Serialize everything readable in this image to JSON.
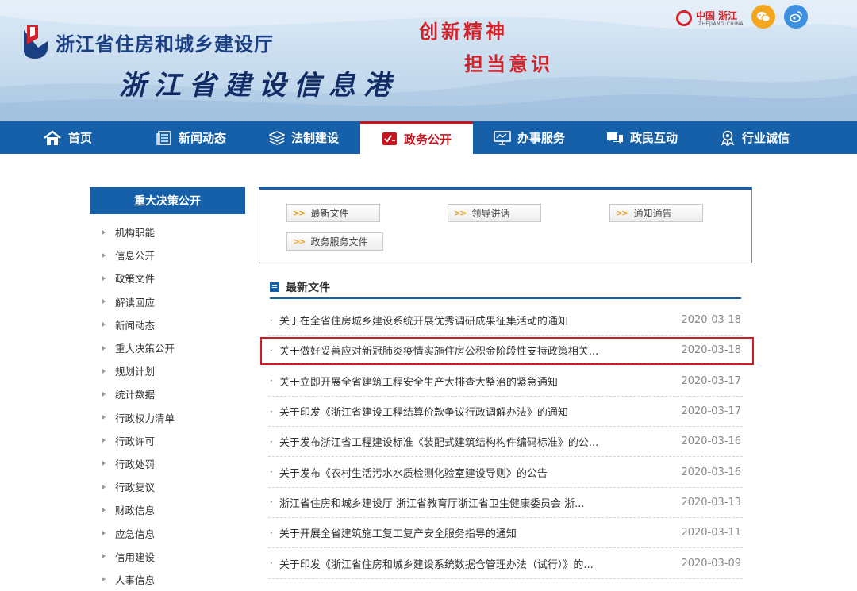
{
  "header": {
    "dept_name": "浙江省住房和城乡建设厅",
    "site_name": "浙江省建设信息港",
    "slogan_1": "创新精神",
    "slogan_2": "担当意识",
    "brand_cn": "中国 浙江",
    "brand_en": "ZHEJIANG·CHINA"
  },
  "nav": {
    "items": [
      {
        "label": "首页",
        "icon": "home-icon"
      },
      {
        "label": "新闻动态",
        "icon": "newspaper-icon"
      },
      {
        "label": "法制建设",
        "icon": "layers-icon"
      },
      {
        "label": "政务公开",
        "icon": "checklist-icon",
        "active": true
      },
      {
        "label": "办事服务",
        "icon": "monitor-icon"
      },
      {
        "label": "政民互动",
        "icon": "chat-icon"
      },
      {
        "label": "行业诚信",
        "icon": "award-icon"
      }
    ]
  },
  "sidebar": {
    "title": "重大决策公开",
    "items": [
      "机构职能",
      "信息公开",
      "政策文件",
      "解读回应",
      "新闻动态",
      "重大决策公开",
      "规划计划",
      "统计数据",
      "行政权力清单",
      "行政许可",
      "行政处罚",
      "行政复议",
      "财政信息",
      "应急信息",
      "信用建设",
      "人事信息"
    ]
  },
  "categories": [
    "最新文件",
    "领导讲话",
    "通知通告",
    "政务服务文件"
  ],
  "section": {
    "title": "最新文件"
  },
  "news": [
    {
      "title": "关于在全省住房城乡建设系统开展优秀调研成果征集活动的通知",
      "date": "2020-03-18"
    },
    {
      "title": "关于做好妥善应对新冠肺炎疫情实施住房公积金阶段性支持政策相关...",
      "date": "2020-03-18"
    },
    {
      "title": "关于立即开展全省建筑工程安全生产大排查大整治的紧急通知",
      "date": "2020-03-17"
    },
    {
      "title": "关于印发《浙江省建设工程结算价款争议行政调解办法》的通知",
      "date": "2020-03-17"
    },
    {
      "title": "关于发布浙江省工程建设标准《装配式建筑结构构件编码标准》的公...",
      "date": "2020-03-16"
    },
    {
      "title": "关于发布《农村生活污水水质检测化验室建设导则》的公告",
      "date": "2020-03-16"
    },
    {
      "title": "浙江省住房和城乡建设厅 浙江省教育厅浙江省卫生健康委员会 浙...",
      "date": "2020-03-13"
    },
    {
      "title": "关于开展全省建筑施工复工复产安全服务指导的通知",
      "date": "2020-03-11"
    },
    {
      "title": "关于印发《浙江省住房和城乡建设系统数据仓管理办法（试行）》的...",
      "date": "2020-03-09"
    }
  ],
  "colors": {
    "primary_blue": "#1660aa",
    "accent_red": "#d01b22",
    "slogan_red": "#d2222a"
  }
}
